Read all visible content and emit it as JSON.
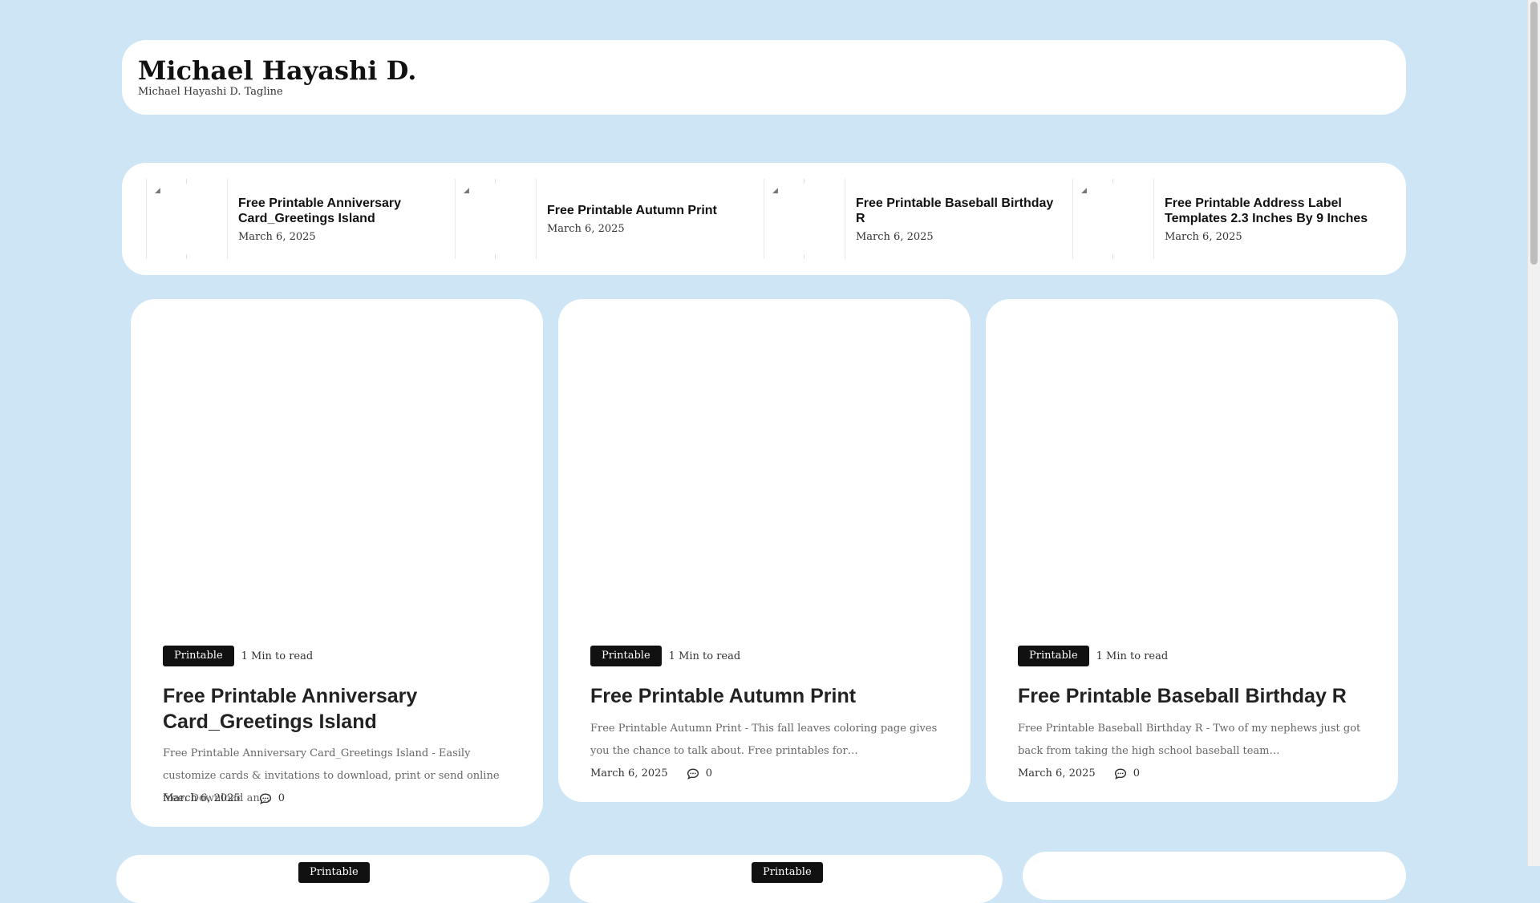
{
  "site": {
    "title": "Michael Hayashi D.",
    "tagline": "Michael Hayashi D. Tagline"
  },
  "recent_posts": [
    {
      "title": "Free Printable Anniversary Card_Greetings Island",
      "date": "March 6, 2025"
    },
    {
      "title": "Free Printable Autumn Print",
      "date": "March 6, 2025"
    },
    {
      "title": "Free Printable Baseball Birthday R",
      "date": "March 6, 2025"
    },
    {
      "title": "Free Printable Address Label Templates 2.3 Inches By 9 Inches",
      "date": "March 6, 2025"
    }
  ],
  "cards": [
    {
      "category": "Printable",
      "read_time": "1 Min to read",
      "title": "Free Printable Anniversary Card_Greetings Island",
      "excerpt": "Free Printable Anniversary Card_Greetings Island - Easily customize cards & invitations to download, print or send online free. Download an…",
      "date": "March 6, 2025",
      "comments": "0"
    },
    {
      "category": "Printable",
      "read_time": "1 Min to read",
      "title": "Free Printable Autumn Print",
      "excerpt": "Free Printable Autumn Print - This fall leaves coloring page gives you the chance to talk about. Free printables for…",
      "date": "March 6, 2025",
      "comments": "0"
    },
    {
      "category": "Printable",
      "read_time": "1 Min to read",
      "title": "Free Printable Baseball Birthday R",
      "excerpt": "Free Printable Baseball Birthday R - Two of my nephews just got back from taking the high school baseball team…",
      "date": "March 6, 2025",
      "comments": "0"
    }
  ],
  "bottom_cards": [
    {
      "category": "Printable"
    },
    {
      "category": "Printable"
    }
  ],
  "icons": {
    "comment": "comment-icon",
    "broken_image": "broken-image-icon"
  }
}
